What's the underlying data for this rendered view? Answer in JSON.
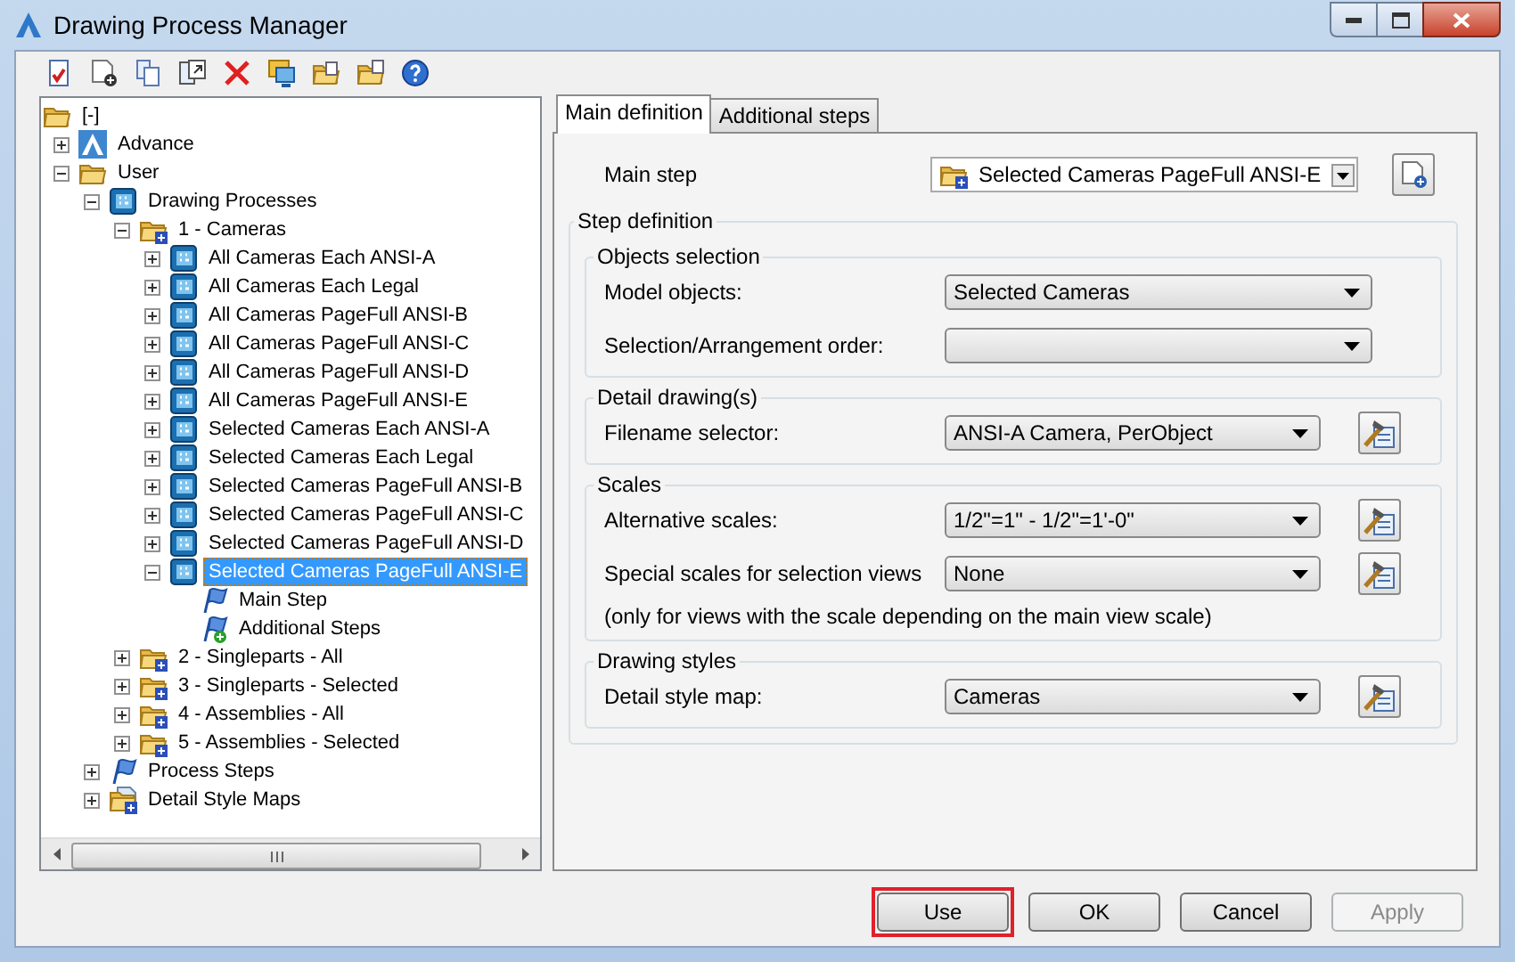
{
  "window": {
    "title": "Drawing Process Manager"
  },
  "tree": {
    "items": [
      {
        "label": "[-]",
        "kind": "folder",
        "selected": false,
        "children": [
          {
            "label": "Advance",
            "kind": "logo",
            "expanded": false,
            "selected": false
          },
          {
            "label": "User",
            "kind": "folder",
            "expanded": true,
            "selected": false,
            "children": [
              {
                "label": "Drawing Processes",
                "kind": "process",
                "expanded": true,
                "selected": false,
                "children": [
                  {
                    "label": "1 - Cameras",
                    "kind": "folder-plus",
                    "expanded": true,
                    "selected": false,
                    "children": [
                      {
                        "label": "All Cameras Each ANSI-A",
                        "kind": "process",
                        "expanded": false,
                        "selected": false
                      },
                      {
                        "label": "All Cameras Each Legal",
                        "kind": "process",
                        "expanded": false,
                        "selected": false
                      },
                      {
                        "label": "All Cameras PageFull ANSI-B",
                        "kind": "process",
                        "expanded": false,
                        "selected": false
                      },
                      {
                        "label": "All Cameras PageFull ANSI-C",
                        "kind": "process",
                        "expanded": false,
                        "selected": false
                      },
                      {
                        "label": "All Cameras PageFull ANSI-D",
                        "kind": "process",
                        "expanded": false,
                        "selected": false
                      },
                      {
                        "label": "All Cameras PageFull ANSI-E",
                        "kind": "process",
                        "expanded": false,
                        "selected": false
                      },
                      {
                        "label": "Selected Cameras Each ANSI-A",
                        "kind": "process",
                        "expanded": false,
                        "selected": false
                      },
                      {
                        "label": "Selected Cameras Each Legal",
                        "kind": "process",
                        "expanded": false,
                        "selected": false
                      },
                      {
                        "label": "Selected Cameras PageFull ANSI-B",
                        "kind": "process",
                        "expanded": false,
                        "selected": false
                      },
                      {
                        "label": "Selected Cameras PageFull ANSI-C",
                        "kind": "process",
                        "expanded": false,
                        "selected": false
                      },
                      {
                        "label": "Selected Cameras PageFull ANSI-D",
                        "kind": "process",
                        "expanded": false,
                        "selected": false
                      },
                      {
                        "label": "Selected Cameras PageFull ANSI-E",
                        "kind": "process",
                        "expanded": true,
                        "selected": true,
                        "children": [
                          {
                            "label": "Main Step",
                            "kind": "flag",
                            "selected": false
                          },
                          {
                            "label": "Additional Steps",
                            "kind": "flag-plus",
                            "selected": false
                          }
                        ]
                      }
                    ]
                  },
                  {
                    "label": "2 - Singleparts - All",
                    "kind": "folder-plus",
                    "expanded": false,
                    "selected": false
                  },
                  {
                    "label": "3 - Singleparts - Selected",
                    "kind": "folder-plus",
                    "expanded": false,
                    "selected": false
                  },
                  {
                    "label": "4 - Assemblies - All",
                    "kind": "folder-plus",
                    "expanded": false,
                    "selected": false
                  },
                  {
                    "label": "5 - Assemblies - Selected",
                    "kind": "folder-plus",
                    "expanded": false,
                    "selected": false
                  }
                ]
              },
              {
                "label": "Process Steps",
                "kind": "flag",
                "expanded": false,
                "selected": false
              },
              {
                "label": "Detail Style Maps",
                "kind": "style-map",
                "expanded": false,
                "selected": false
              }
            ]
          }
        ]
      }
    ]
  },
  "tabs": [
    {
      "label": "Main definition",
      "selected": true
    },
    {
      "label": "Additional steps",
      "selected": false
    }
  ],
  "main_step": {
    "label": "Main step",
    "value": "Selected Cameras PageFull ANSI-E"
  },
  "step_definition": {
    "title": "Step definition",
    "groups": [
      {
        "title": "Objects selection",
        "rows": [
          {
            "label": "Model objects:",
            "value": "Selected Cameras",
            "edit_button": false
          },
          {
            "label": "Selection/Arrangement order:",
            "edit_button": false
          }
        ]
      },
      {
        "title": "Detail drawing(s)",
        "rows": [
          {
            "label": "Filename selector:",
            "value": "ANSI-A Camera, PerObject",
            "edit_button": true
          }
        ]
      },
      {
        "title": "Scales",
        "rows": [
          {
            "label": "Alternative scales:",
            "value": "1/2\"=1\" - 1/2\"=1'-0\"",
            "edit_button": true
          },
          {
            "label": "Special scales for selection views",
            "value": "None",
            "edit_button": true
          }
        ],
        "note": "(only for views with the scale depending on the main view scale)"
      },
      {
        "title": "Drawing styles",
        "rows": [
          {
            "label": "Detail style map:",
            "value": "Cameras",
            "edit_button": true
          }
        ]
      }
    ]
  },
  "buttons": [
    {
      "label": "Use",
      "highlighted": true,
      "disabled": false
    },
    {
      "label": "OK",
      "highlighted": false,
      "disabled": false
    },
    {
      "label": "Cancel",
      "highlighted": false,
      "disabled": false
    },
    {
      "label": "Apply",
      "highlighted": false,
      "disabled": true
    }
  ]
}
